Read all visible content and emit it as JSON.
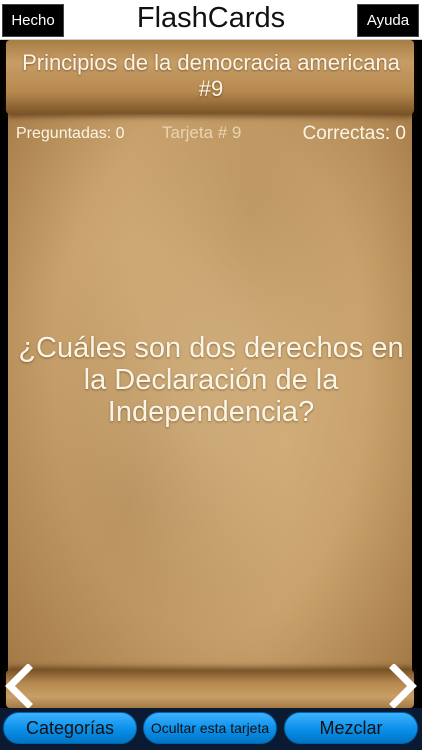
{
  "header": {
    "title": "FlashCards",
    "done_label": "Hecho",
    "help_label": "Ayuda"
  },
  "card": {
    "deck_title": "Principios de la democracia americana #9",
    "stats": {
      "asked": "Preguntadas: 0",
      "card_number": "Tarjeta # 9",
      "correct": "Correctas: 0"
    },
    "question": "¿Cuáles son dos derechos en la Declaración de la Independencia?"
  },
  "icons": {
    "prev": "chevron-left-icon",
    "next": "chevron-right-icon"
  },
  "toolbar": {
    "categories_label": "Categorías",
    "hide_card_label": "Ocultar esta tarjeta",
    "shuffle_label": "Mezclar"
  },
  "colors": {
    "parchment": "#c9a26d",
    "pill_blue": "#0a8fe8",
    "text_light": "#fbf5e6"
  }
}
